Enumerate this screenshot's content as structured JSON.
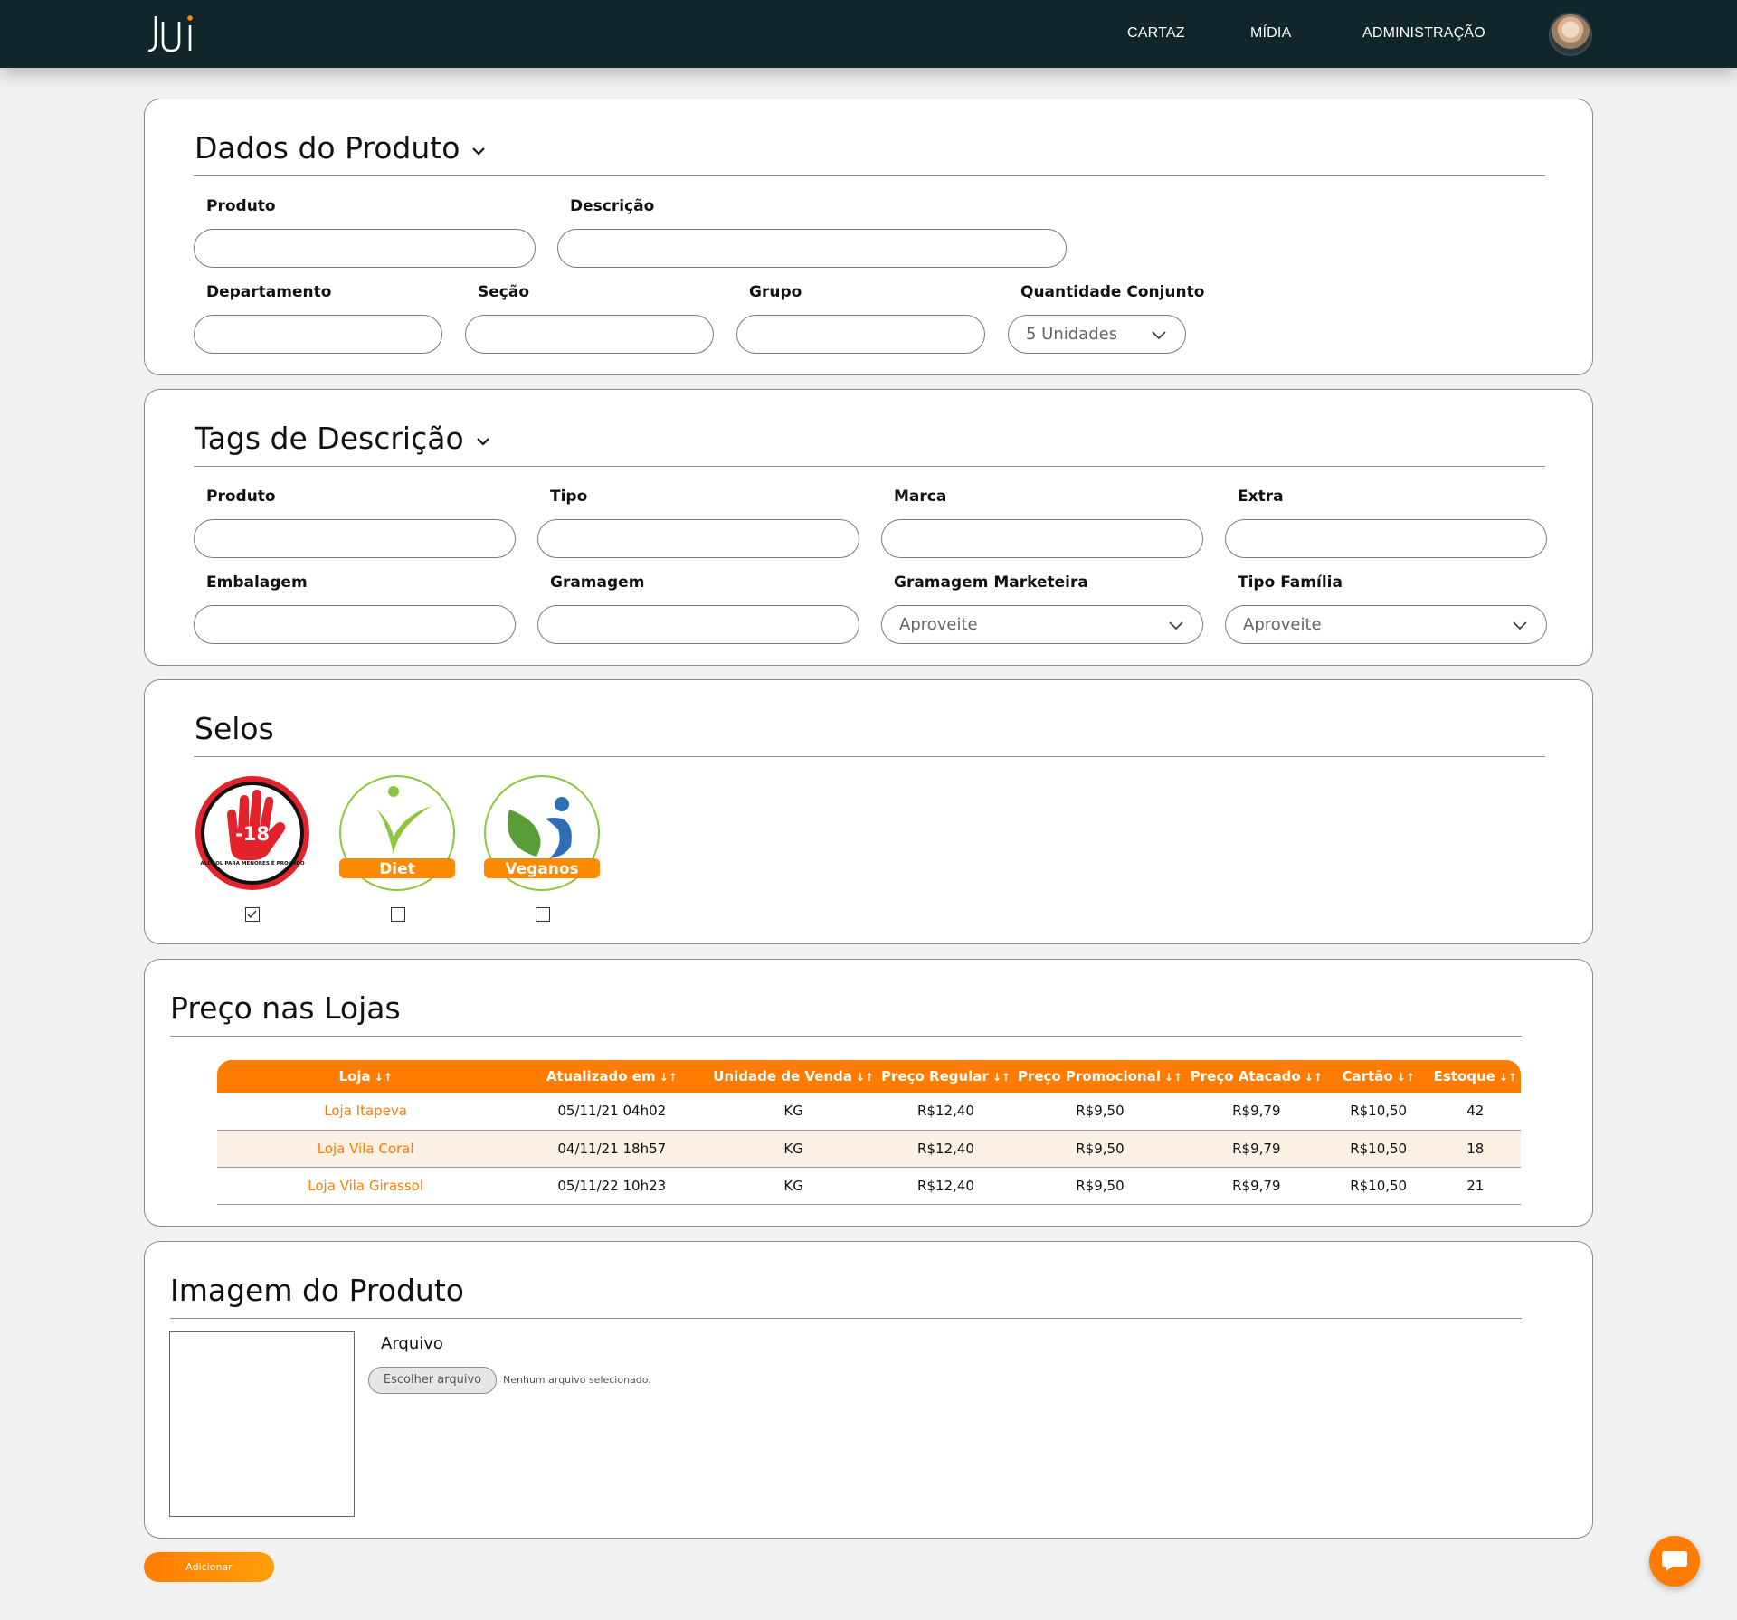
{
  "nav": {
    "logo_text": "JUi",
    "items": [
      "CARTAZ",
      "MÍDIA",
      "ADMINISTRAÇÃO"
    ]
  },
  "dados_produto": {
    "title": "Dados do Produto",
    "labels": {
      "produto": "Produto",
      "descricao": "Descrição",
      "departamento": "Departamento",
      "secao": "Seção",
      "grupo": "Grupo",
      "quantidade": "Quantidade Conjunto"
    },
    "quantidade_value": "5 Unidades"
  },
  "tags": {
    "title": "Tags de Descrição",
    "labels": {
      "produto": "Produto",
      "tipo": "Tipo",
      "marca": "Marca",
      "extra": "Extra",
      "embalagem": "Embalagem",
      "gramagem": "Gramagem",
      "gramagem_marketeira": "Gramagem Marketeira",
      "tipo_familia": "Tipo Família"
    },
    "gramagem_marketeira_value": "Aproveite",
    "tipo_familia_value": "Aproveite"
  },
  "selos": {
    "title": "Selos",
    "items": [
      {
        "name": "-18",
        "caption": "ÁLCOOL PARA MENORES É PROIBIDO",
        "checked": true,
        "color": "#e3232b"
      },
      {
        "name": "Diet",
        "checked": false,
        "color": "#ff8a00"
      },
      {
        "name": "Veganos",
        "checked": false,
        "color": "#ff8a00"
      }
    ]
  },
  "precos": {
    "title": "Preço nas Lojas",
    "sort_icon": "↓↑",
    "columns": [
      "Loja",
      "Atualizado em",
      "Unidade de Venda",
      "Preço Regular",
      "Preço Promocional",
      "Preço Atacado",
      "Cartão",
      "Estoque"
    ],
    "rows": [
      [
        "Loja Itapeva",
        "05/11/21 04h02",
        "KG",
        "R$12,40",
        "R$9,50",
        "R$9,79",
        "R$10,50",
        "42"
      ],
      [
        "Loja Vila Coral",
        "04/11/21 18h57",
        "KG",
        "R$12,40",
        "R$9,50",
        "R$9,79",
        "R$10,50",
        "18"
      ],
      [
        "Loja Vila Girassol",
        "05/11/22 10h23",
        "KG",
        "R$12,40",
        "R$9,50",
        "R$9,79",
        "R$10,50",
        "21"
      ]
    ]
  },
  "imagem": {
    "title": "Imagem do Produto",
    "arquivo_label": "Arquivo",
    "file_button": "Escolher arquivo",
    "file_status": "Nenhum arquivo selecionado."
  },
  "actions": {
    "add_label": "Adicionar"
  },
  "colors": {
    "accent": "#ff7c00",
    "topbar": "#10262a"
  }
}
